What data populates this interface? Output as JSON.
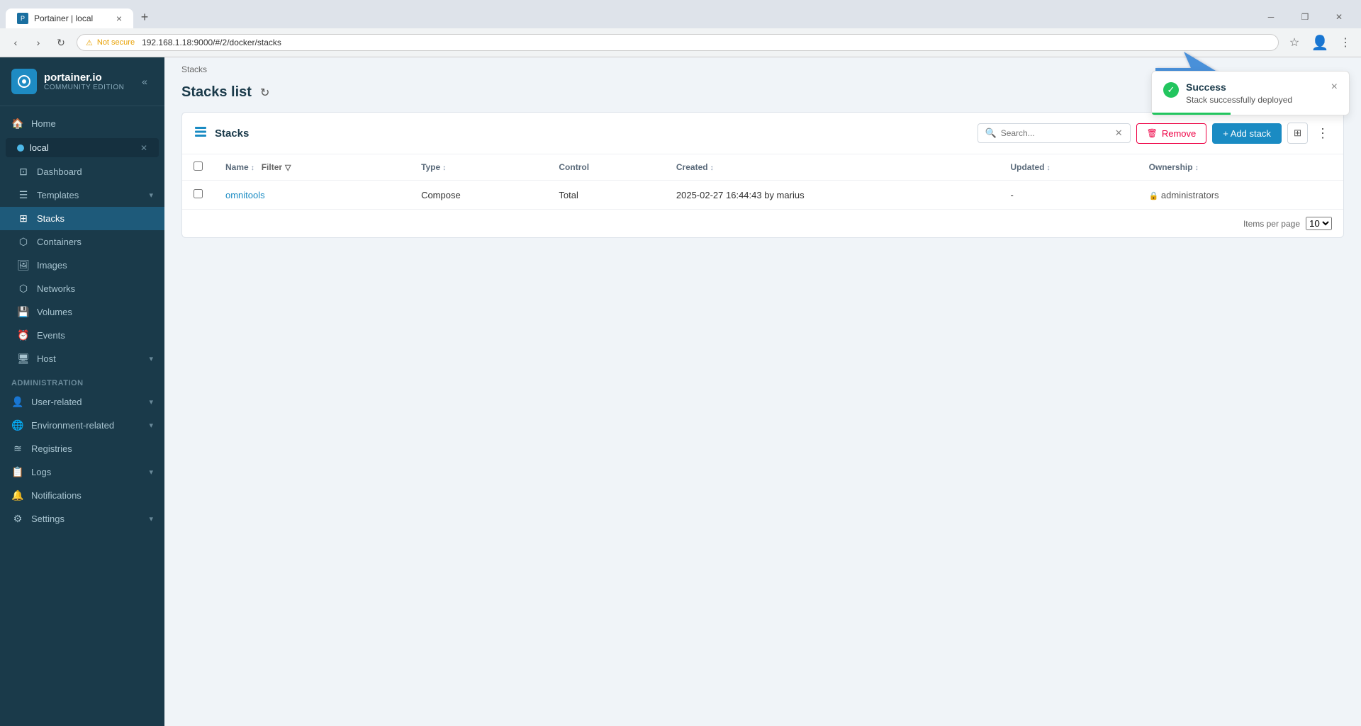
{
  "browser": {
    "tab_title": "Portainer | local",
    "url": "192.168.1.18:9000/#/2/docker/stacks",
    "security_label": "Not secure"
  },
  "sidebar": {
    "brand": "portainer.io",
    "edition": "COMMUNITY EDITION",
    "nav_items": [
      {
        "id": "home",
        "label": "Home",
        "icon": "🏠",
        "active": false
      },
      {
        "id": "local",
        "label": "local",
        "icon": "●",
        "active": false,
        "has_close": true
      },
      {
        "id": "dashboard",
        "label": "Dashboard",
        "icon": "⊡",
        "active": false,
        "indent": true
      },
      {
        "id": "templates",
        "label": "Templates",
        "icon": "≡",
        "active": false,
        "indent": true,
        "has_chevron": true
      },
      {
        "id": "stacks",
        "label": "Stacks",
        "icon": "⊞",
        "active": true,
        "indent": true
      },
      {
        "id": "containers",
        "label": "Containers",
        "icon": "⬡",
        "active": false,
        "indent": true
      },
      {
        "id": "images",
        "label": "Images",
        "icon": "🖼",
        "active": false,
        "indent": true
      },
      {
        "id": "networks",
        "label": "Networks",
        "icon": "⬡",
        "active": false,
        "indent": true
      },
      {
        "id": "volumes",
        "label": "Volumes",
        "icon": "💾",
        "active": false,
        "indent": true
      },
      {
        "id": "events",
        "label": "Events",
        "icon": "⏰",
        "active": false,
        "indent": true
      },
      {
        "id": "host",
        "label": "Host",
        "icon": "🖥",
        "active": false,
        "indent": true,
        "has_chevron": true
      }
    ],
    "admin_section": "Administration",
    "admin_items": [
      {
        "id": "user-related",
        "label": "User-related",
        "icon": "👤",
        "has_chevron": true
      },
      {
        "id": "environment-related",
        "label": "Environment-related",
        "icon": "🌐",
        "has_chevron": true
      },
      {
        "id": "registries",
        "label": "Registries",
        "icon": "≋",
        "has_chevron": false
      },
      {
        "id": "logs",
        "label": "Logs",
        "icon": "📋",
        "has_chevron": true
      },
      {
        "id": "notifications",
        "label": "Notifications",
        "icon": "🔔",
        "has_chevron": false
      },
      {
        "id": "settings",
        "label": "Settings",
        "icon": "⚙",
        "has_chevron": true
      }
    ]
  },
  "page": {
    "breadcrumb": "Stacks",
    "title": "Stacks list"
  },
  "stacks_card": {
    "header_title": "Stacks",
    "search_placeholder": "Search...",
    "remove_label": "Remove",
    "add_stack_label": "+ Add stack",
    "table": {
      "columns": [
        {
          "id": "name",
          "label": "Name",
          "sortable": true
        },
        {
          "id": "filter",
          "label": "Filter"
        },
        {
          "id": "type",
          "label": "Type",
          "sortable": true
        },
        {
          "id": "control",
          "label": "Control"
        },
        {
          "id": "created",
          "label": "Created",
          "sortable": true
        },
        {
          "id": "updated",
          "label": "Updated",
          "sortable": true
        },
        {
          "id": "ownership",
          "label": "Ownership",
          "sortable": true
        }
      ],
      "rows": [
        {
          "name": "omnitools",
          "type": "Compose",
          "control": "Total",
          "created": "2025-02-27 16:44:43 by marius",
          "updated": "-",
          "ownership": "administrators"
        }
      ]
    },
    "footer": {
      "items_per_page_label": "Items per page",
      "items_per_page_value": "10"
    }
  },
  "toast": {
    "title": "Success",
    "message": "Stack successfully deployed",
    "close_label": "×"
  }
}
